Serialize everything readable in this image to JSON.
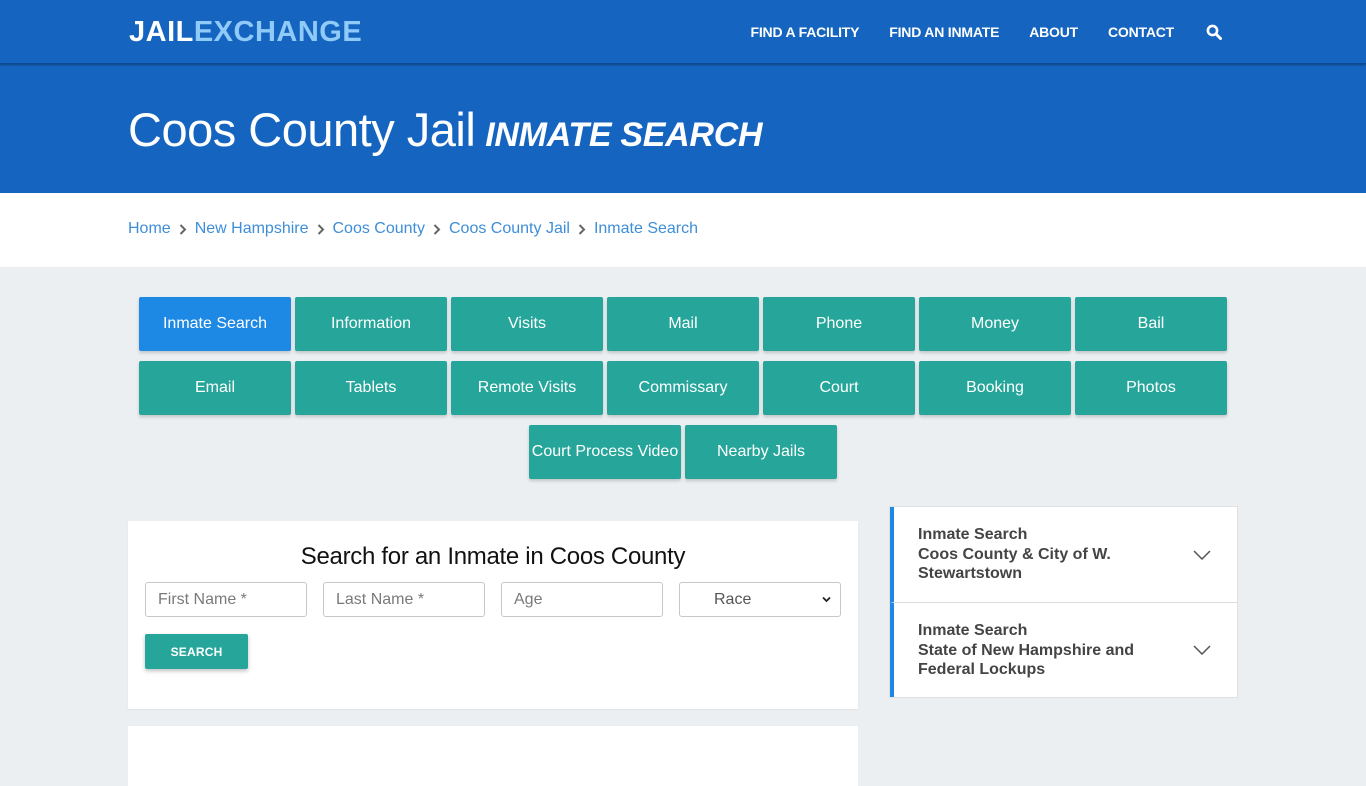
{
  "header": {
    "logo": {
      "part1": "JAIL",
      "part2": "EXCHANGE"
    },
    "nav": [
      {
        "label": "FIND A FACILITY"
      },
      {
        "label": "FIND AN INMATE"
      },
      {
        "label": "ABOUT"
      },
      {
        "label": "CONTACT"
      }
    ],
    "search_icon": "search-icon"
  },
  "hero": {
    "title": "Coos County Jail",
    "subtitle": "INMATE SEARCH"
  },
  "breadcrumb": [
    {
      "label": "Home"
    },
    {
      "label": "New Hampshire"
    },
    {
      "label": "Coos County"
    },
    {
      "label": "Coos County Jail"
    },
    {
      "label": "Inmate Search"
    }
  ],
  "tabs": {
    "active": "Inmate Search",
    "rows": [
      [
        "Inmate Search",
        "Information",
        "Visits",
        "Mail",
        "Phone",
        "Money",
        "Bail"
      ],
      [
        "Email",
        "Tablets",
        "Remote Visits",
        "Commissary",
        "Court",
        "Booking",
        "Photos"
      ],
      [
        "Court Process Video",
        "Nearby Jails"
      ]
    ]
  },
  "search_form": {
    "heading": "Search for an Inmate in Coos County",
    "first_name": {
      "placeholder": "First Name *",
      "value": ""
    },
    "last_name": {
      "placeholder": "Last Name *",
      "value": ""
    },
    "age": {
      "placeholder": "Age",
      "value": ""
    },
    "race": {
      "selected": "Race"
    },
    "submit_label": "SEARCH"
  },
  "sidebar": {
    "items": [
      {
        "line1": "Inmate Search",
        "line2": "Coos County & City of W. Stewartstown"
      },
      {
        "line1": "Inmate Search",
        "line2": "State of New Hampshire and Federal Lockups"
      }
    ]
  },
  "colors": {
    "brand_blue": "#1565c0",
    "logo_accent": "#90caf9",
    "teal_button": "#26a69a",
    "active_tab": "#1e88e5",
    "link_blue": "#3e8ed8",
    "page_bg": "#eceff1"
  }
}
